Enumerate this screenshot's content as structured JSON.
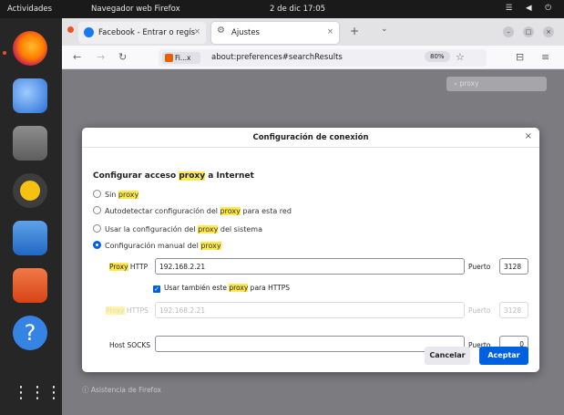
{
  "topbar": {
    "activities": "Actividades",
    "app": "Navegador web Firefox",
    "clock": "2 de dic 17:05",
    "tray": "☰ ◀ ⏻"
  },
  "dock": {
    "items": [
      "firefox",
      "thunderbird",
      "files",
      "rhythmbox",
      "libreoffice-writer",
      "ubuntu-software",
      "help",
      "show-apps"
    ]
  },
  "browser": {
    "tabs": [
      {
        "label": "Facebook - Entrar o regís",
        "color": "#1877f2"
      },
      {
        "label": "Ajustes",
        "color": "#777777"
      }
    ],
    "site_identity": "Fi...x",
    "url": "about:preferences#searchResults",
    "zoom": "80%",
    "prefs_search": "proxy",
    "support_link": "Asistencia de Firefox"
  },
  "dialog": {
    "title": "Configuración de conexión",
    "heading_pre": "Configurar acceso ",
    "heading_hl": "proxy",
    "heading_post": " a Internet",
    "options": [
      {
        "pre": "Sin ",
        "hl": "proxy",
        "post": "",
        "selected": false
      },
      {
        "pre": "Autodetectar configuración del ",
        "hl": "proxy",
        "post": " para esta red",
        "selected": false
      },
      {
        "pre": "Usar la configuración del ",
        "hl": "proxy",
        "post": " del sistema",
        "selected": false
      },
      {
        "pre": "Configuración manual del ",
        "hl": "proxy",
        "post": "",
        "selected": true
      }
    ],
    "http_label_hl": "Proxy",
    "http_label_post": " HTTP",
    "http_value": "192.168.2.21",
    "port_label": "Puerto",
    "http_port": "3128",
    "https_checkbox_pre": "Usar también este ",
    "https_checkbox_hl": "proxy",
    "https_checkbox_post": " para HTTPS",
    "https_label_hl": "Proxy",
    "https_label_post": " HTTPS",
    "https_value": "192.168.2.21",
    "https_port": "3128",
    "socks_label": "Host SOCKS",
    "socks_port": "0",
    "cancel": "Cancelar",
    "accept": "Aceptar"
  }
}
